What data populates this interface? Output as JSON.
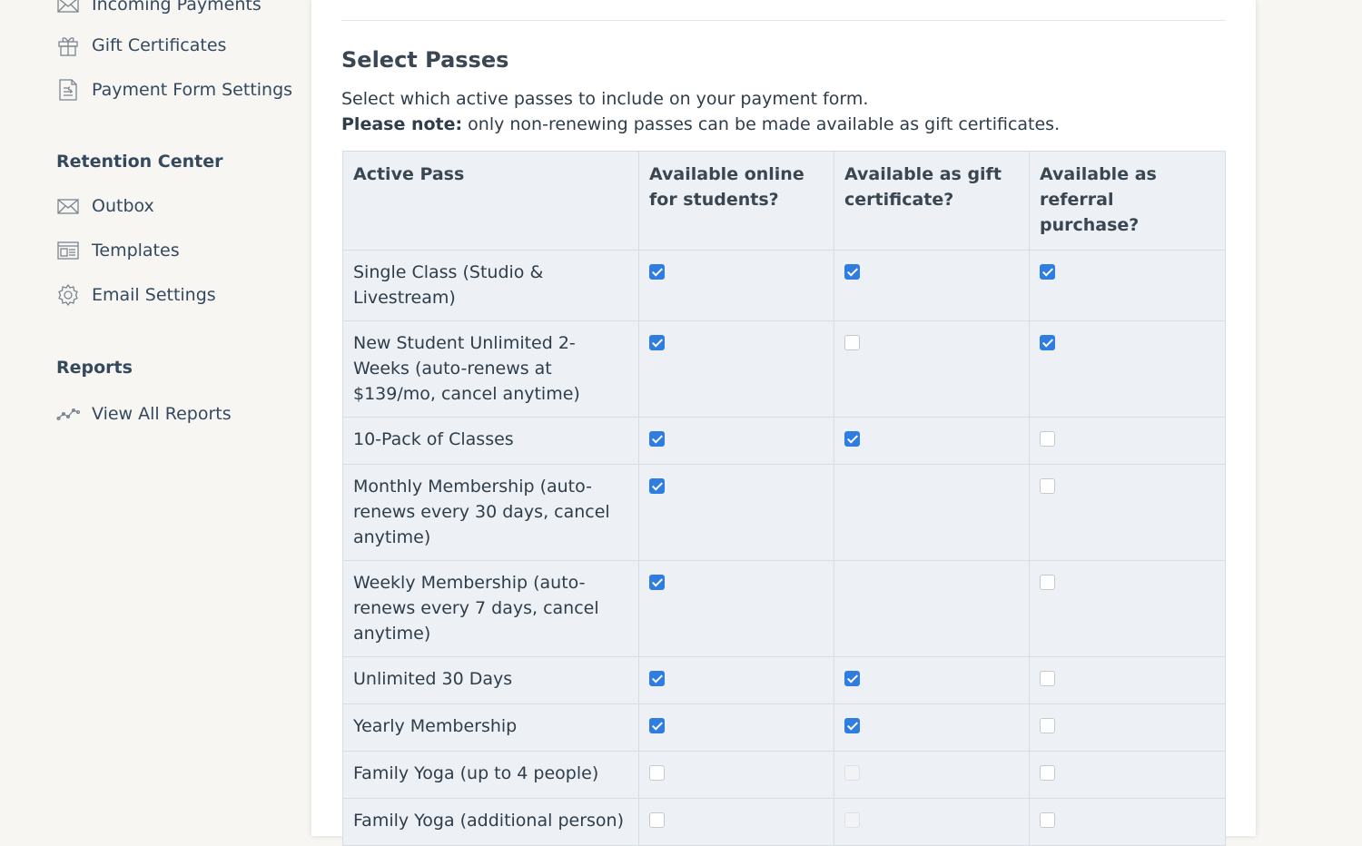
{
  "sidebar": {
    "payments_items": [
      {
        "label": "Incoming Payments",
        "icon": "envelope-icon"
      },
      {
        "label": "Gift Certificates",
        "icon": "gift-icon"
      },
      {
        "label": "Payment Form Settings",
        "icon": "form-document-icon"
      }
    ],
    "retention": {
      "title": "Retention Center",
      "items": [
        {
          "label": "Outbox",
          "icon": "envelope-icon"
        },
        {
          "label": "Templates",
          "icon": "template-icon"
        },
        {
          "label": "Email Settings",
          "icon": "gear-icon"
        }
      ]
    },
    "reports": {
      "title": "Reports",
      "items": [
        {
          "label": "View All Reports",
          "icon": "line-chart-icon"
        }
      ]
    }
  },
  "main": {
    "heading": "Select Passes",
    "description": "Select which active passes to include on your payment form.",
    "note_bold": "Please note:",
    "note_text": " only non-renewing passes can be made available as gift certificates.",
    "table": {
      "headers": [
        "Active Pass",
        "Available online for students?",
        "Available as gift certificate?",
        "Available as referral purchase?"
      ],
      "rows": [
        {
          "name": "Single Class (Studio & Livestream)",
          "online": "checked",
          "gift": "checked",
          "referral": "checked"
        },
        {
          "name": "New Student Unlimited 2-Weeks (auto-renews at $139/mo, cancel anytime)",
          "online": "checked",
          "gift": "unchecked",
          "referral": "checked"
        },
        {
          "name": "10-Pack of Classes",
          "online": "checked",
          "gift": "checked",
          "referral": "unchecked"
        },
        {
          "name": "Monthly Membership (auto-renews every 30 days, cancel anytime)",
          "online": "checked",
          "gift": "none",
          "referral": "unchecked"
        },
        {
          "name": "Weekly Membership (auto-renews every 7 days, cancel anytime)",
          "online": "checked",
          "gift": "none",
          "referral": "unchecked"
        },
        {
          "name": "Unlimited 30 Days",
          "online": "checked",
          "gift": "checked",
          "referral": "unchecked"
        },
        {
          "name": "Yearly Membership",
          "online": "checked",
          "gift": "checked",
          "referral": "unchecked"
        },
        {
          "name": "Family Yoga (up to 4 people)",
          "online": "unchecked",
          "gift": "disabled",
          "referral": "unchecked"
        },
        {
          "name": "Family Yoga (additional person)",
          "online": "unchecked",
          "gift": "disabled",
          "referral": "unchecked"
        }
      ]
    }
  },
  "colors": {
    "checkbox_checked": "#2f7de1",
    "table_bg": "#edf1f5",
    "page_bg": "#f7f6f3",
    "text": "#2f3d4a"
  }
}
